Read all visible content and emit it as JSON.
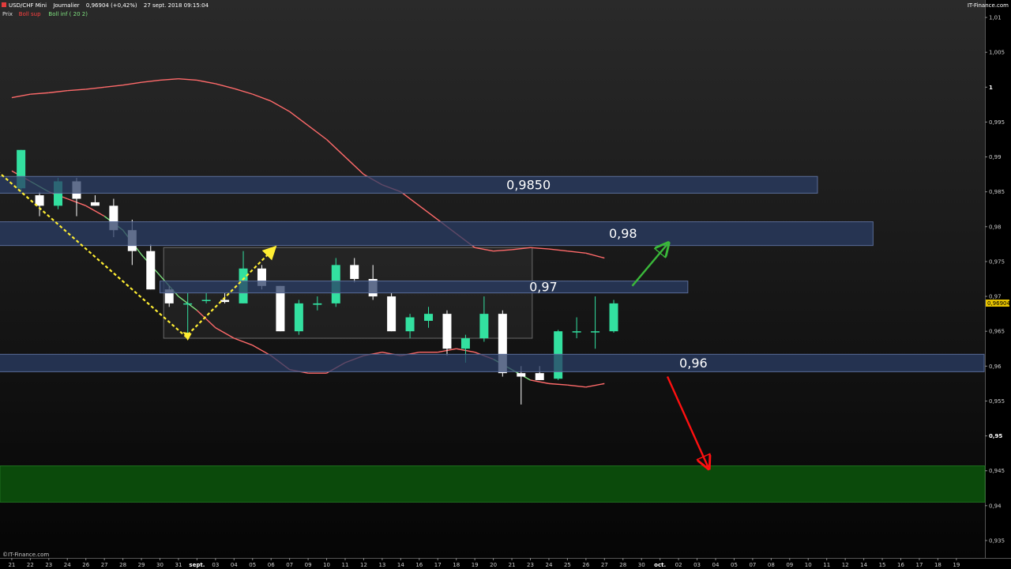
{
  "header": {
    "symbol": "USD/CHF Mini",
    "period": "Journalier",
    "price_change": "0,96904 (+0,42%)",
    "datetime": "27 sept. 2018 09:15:04",
    "source": "IT-Finance.com"
  },
  "legend": [
    {
      "label": "Prix",
      "color": "#dddddd"
    },
    {
      "label": "Boll sup",
      "color": "#ff4040"
    },
    {
      "label": "Boll inf ( 20 2)",
      "color": "#7fe27f"
    }
  ],
  "footer": {
    "copyright": "©IT-Finance.com"
  },
  "colors": {
    "background": "#000000",
    "plot_gradient_top": "#2a2a2a",
    "plot_gradient_bottom": "#050505",
    "bull": "#33e0a0",
    "bear": "#ffffff",
    "zone_fill": "#2b3d66",
    "target_zone": "#0b4a0b",
    "price_tag": "#e8c400"
  },
  "chart_data": {
    "type": "candlestick",
    "y_axis": {
      "ylim": [
        0.9325,
        1.0125
      ],
      "ticks": [
        {
          "value": 1.01,
          "label": "1,01"
        },
        {
          "value": 1.005,
          "label": "1,005"
        },
        {
          "value": 1.0,
          "label": "1",
          "bold": true
        },
        {
          "value": 0.995,
          "label": "0,995"
        },
        {
          "value": 0.99,
          "label": "0,99"
        },
        {
          "value": 0.985,
          "label": "0,985"
        },
        {
          "value": 0.98,
          "label": "0,98"
        },
        {
          "value": 0.975,
          "label": "0,975"
        },
        {
          "value": 0.97,
          "label": "0,97"
        },
        {
          "value": 0.965,
          "label": "0,965"
        },
        {
          "value": 0.96,
          "label": "0,96"
        },
        {
          "value": 0.955,
          "label": "0,955"
        },
        {
          "value": 0.95,
          "label": "0,95",
          "bold": true
        },
        {
          "value": 0.945,
          "label": "0,945"
        },
        {
          "value": 0.94,
          "label": "0,94"
        },
        {
          "value": 0.935,
          "label": "0,935"
        }
      ],
      "current_price": {
        "value": 0.96904,
        "label": "0,96904"
      }
    },
    "x_axis": {
      "ticks": [
        {
          "label": "21"
        },
        {
          "label": "22"
        },
        {
          "label": "23"
        },
        {
          "label": "24"
        },
        {
          "label": "26"
        },
        {
          "label": "27"
        },
        {
          "label": "28"
        },
        {
          "label": "29"
        },
        {
          "label": "30"
        },
        {
          "label": "31"
        },
        {
          "label": "sept.",
          "bold": true
        },
        {
          "label": "03"
        },
        {
          "label": "04"
        },
        {
          "label": "05"
        },
        {
          "label": "06"
        },
        {
          "label": "07"
        },
        {
          "label": "09"
        },
        {
          "label": "10"
        },
        {
          "label": "11"
        },
        {
          "label": "12"
        },
        {
          "label": "13"
        },
        {
          "label": "14"
        },
        {
          "label": "16"
        },
        {
          "label": "17"
        },
        {
          "label": "18"
        },
        {
          "label": "19"
        },
        {
          "label": "20"
        },
        {
          "label": "21"
        },
        {
          "label": "23"
        },
        {
          "label": "24"
        },
        {
          "label": "25"
        },
        {
          "label": "26"
        },
        {
          "label": "27"
        },
        {
          "label": "28"
        },
        {
          "label": "30"
        },
        {
          "label": "oct.",
          "bold": true
        },
        {
          "label": "02"
        },
        {
          "label": "03"
        },
        {
          "label": "04"
        },
        {
          "label": "05"
        },
        {
          "label": "07"
        },
        {
          "label": "08"
        },
        {
          "label": "09"
        },
        {
          "label": "10"
        },
        {
          "label": "11"
        },
        {
          "label": "12"
        },
        {
          "label": "14"
        },
        {
          "label": "15"
        },
        {
          "label": "16"
        },
        {
          "label": "17"
        },
        {
          "label": "18"
        },
        {
          "label": "19"
        }
      ]
    },
    "candles": [
      {
        "i": 0.5,
        "o": 0.9855,
        "h": 0.991,
        "l": 0.985,
        "c": 0.991
      },
      {
        "i": 1.5,
        "o": 0.9845,
        "h": 0.985,
        "l": 0.9815,
        "c": 0.983
      },
      {
        "i": 2.5,
        "o": 0.983,
        "h": 0.987,
        "l": 0.9825,
        "c": 0.9865
      },
      {
        "i": 3.5,
        "o": 0.9865,
        "h": 0.987,
        "l": 0.9815,
        "c": 0.984
      },
      {
        "i": 4.5,
        "o": 0.9835,
        "h": 0.9845,
        "l": 0.983,
        "c": 0.983
      },
      {
        "i": 5.5,
        "o": 0.983,
        "h": 0.984,
        "l": 0.9785,
        "c": 0.9795
      },
      {
        "i": 6.5,
        "o": 0.9795,
        "h": 0.981,
        "l": 0.9745,
        "c": 0.9765
      },
      {
        "i": 7.5,
        "o": 0.9765,
        "h": 0.9775,
        "l": 0.971,
        "c": 0.971
      },
      {
        "i": 8.5,
        "o": 0.971,
        "h": 0.9715,
        "l": 0.9685,
        "c": 0.969
      },
      {
        "i": 9.5,
        "o": 0.969,
        "h": 0.9705,
        "l": 0.964,
        "c": 0.969
      },
      {
        "i": 10.5,
        "o": 0.9695,
        "h": 0.9705,
        "l": 0.969,
        "c": 0.9695
      },
      {
        "i": 11.5,
        "o": 0.9695,
        "h": 0.9705,
        "l": 0.969,
        "c": 0.9692
      },
      {
        "i": 12.5,
        "o": 0.969,
        "h": 0.9765,
        "l": 0.969,
        "c": 0.974
      },
      {
        "i": 13.5,
        "o": 0.974,
        "h": 0.9745,
        "l": 0.971,
        "c": 0.9715
      },
      {
        "i": 14.5,
        "o": 0.9715,
        "h": 0.9715,
        "l": 0.965,
        "c": 0.965
      },
      {
        "i": 15.5,
        "o": 0.965,
        "h": 0.9695,
        "l": 0.9645,
        "c": 0.969
      },
      {
        "i": 16.5,
        "o": 0.9688,
        "h": 0.97,
        "l": 0.968,
        "c": 0.969
      },
      {
        "i": 17.5,
        "o": 0.969,
        "h": 0.9755,
        "l": 0.9685,
        "c": 0.9745
      },
      {
        "i": 18.5,
        "o": 0.9745,
        "h": 0.9755,
        "l": 0.972,
        "c": 0.9725
      },
      {
        "i": 19.5,
        "o": 0.9725,
        "h": 0.9745,
        "l": 0.9695,
        "c": 0.97
      },
      {
        "i": 20.5,
        "o": 0.97,
        "h": 0.9705,
        "l": 0.965,
        "c": 0.965
      },
      {
        "i": 21.5,
        "o": 0.965,
        "h": 0.9675,
        "l": 0.964,
        "c": 0.967
      },
      {
        "i": 22.5,
        "o": 0.9665,
        "h": 0.9685,
        "l": 0.9655,
        "c": 0.9675
      },
      {
        "i": 23.5,
        "o": 0.9675,
        "h": 0.968,
        "l": 0.9615,
        "c": 0.9625
      },
      {
        "i": 24.5,
        "o": 0.9625,
        "h": 0.9645,
        "l": 0.9605,
        "c": 0.964
      },
      {
        "i": 25.5,
        "o": 0.964,
        "h": 0.97,
        "l": 0.9635,
        "c": 0.9675
      },
      {
        "i": 26.5,
        "o": 0.9675,
        "h": 0.968,
        "l": 0.9585,
        "c": 0.959
      },
      {
        "i": 27.5,
        "o": 0.959,
        "h": 0.96,
        "l": 0.9545,
        "c": 0.9585
      },
      {
        "i": 28.5,
        "o": 0.959,
        "h": 0.96,
        "l": 0.958,
        "c": 0.958
      },
      {
        "i": 29.5,
        "o": 0.9582,
        "h": 0.9652,
        "l": 0.958,
        "c": 0.965
      },
      {
        "i": 30.5,
        "o": 0.965,
        "h": 0.967,
        "l": 0.964,
        "c": 0.965
      },
      {
        "i": 31.5,
        "o": 0.965,
        "h": 0.97,
        "l": 0.9625,
        "c": 0.965
      },
      {
        "i": 32.5,
        "o": 0.965,
        "h": 0.9695,
        "l": 0.9648,
        "c": 0.969
      }
    ],
    "series": [
      {
        "role": "Boll sup",
        "points": [
          [
            0,
            0.988
          ],
          [
            1,
            0.9865
          ],
          [
            2,
            0.985
          ],
          [
            3,
            0.984
          ],
          [
            4,
            0.983
          ],
          [
            5,
            0.9815
          ],
          [
            6,
            0.9795
          ],
          [
            7,
            0.976
          ],
          [
            8,
            0.973
          ],
          [
            9,
            0.97
          ],
          [
            10,
            0.968
          ],
          [
            11,
            0.9655
          ],
          [
            12,
            0.964
          ],
          [
            13,
            0.963
          ],
          [
            14,
            0.9615
          ],
          [
            15,
            0.9595
          ],
          [
            16,
            0.959
          ],
          [
            17,
            0.959
          ],
          [
            18,
            0.9605
          ],
          [
            19,
            0.9615
          ],
          [
            20,
            0.962
          ],
          [
            21,
            0.9615
          ],
          [
            22,
            0.962
          ],
          [
            23,
            0.962
          ],
          [
            24,
            0.9625
          ],
          [
            25,
            0.962
          ],
          [
            26,
            0.961
          ],
          [
            27,
            0.9595
          ],
          [
            28,
            0.958
          ],
          [
            29,
            0.9575
          ],
          [
            30,
            0.9573
          ],
          [
            31,
            0.957
          ],
          [
            32,
            0.9575
          ]
        ]
      },
      {
        "role": "Boll inf",
        "points": [
          [
            0,
            0.9985
          ],
          [
            1,
            0.999
          ],
          [
            2,
            0.9992
          ],
          [
            3,
            0.9995
          ],
          [
            4,
            0.9997
          ],
          [
            5,
            1.0
          ],
          [
            6,
            1.0003
          ],
          [
            7,
            1.0007
          ],
          [
            8,
            1.001
          ],
          [
            9,
            1.0012
          ],
          [
            10,
            1.001
          ],
          [
            11,
            1.0005
          ],
          [
            12,
            0.9998
          ],
          [
            13,
            0.999
          ],
          [
            14,
            0.998
          ],
          [
            15,
            0.9965
          ],
          [
            16,
            0.9945
          ],
          [
            17,
            0.9925
          ],
          [
            18,
            0.99
          ],
          [
            19,
            0.9875
          ],
          [
            20,
            0.986
          ],
          [
            21,
            0.985
          ],
          [
            22,
            0.983
          ],
          [
            23,
            0.981
          ],
          [
            24,
            0.979
          ],
          [
            25,
            0.977
          ],
          [
            26,
            0.9765
          ],
          [
            27,
            0.9767
          ],
          [
            28,
            0.977
          ],
          [
            29,
            0.9768
          ],
          [
            30,
            0.9765
          ],
          [
            31,
            0.9762
          ],
          [
            32,
            0.9755
          ]
        ]
      }
    ],
    "zones": [
      {
        "label": "0,9850",
        "from_i": -1,
        "to_i": 43.5,
        "y1": 0.9848,
        "y2": 0.9872
      },
      {
        "label": "0,98",
        "from_i": -1,
        "to_i": 46.5,
        "y1": 0.9773,
        "y2": 0.9807
      },
      {
        "label": "0,97",
        "from_i": 8,
        "to_i": 36.5,
        "y1": 0.9705,
        "y2": 0.9722
      },
      {
        "label": "0,96",
        "from_i": -1,
        "to_i": 52.5,
        "y1": 0.9592,
        "y2": 0.9617
      }
    ],
    "range_box": {
      "from_i": 8.2,
      "to_i": 28.1,
      "y1": 0.964,
      "y2": 0.977
    },
    "target_zone": {
      "y1": 0.9405,
      "y2": 0.9457
    },
    "annotations": [
      {
        "kind": "dotted-line",
        "color": "#ffee33",
        "points": [
          [
            -1,
            0.9885
          ],
          [
            9.5,
            0.964
          ]
        ]
      },
      {
        "kind": "dotted-arrow",
        "color": "#ffee33",
        "points": [
          [
            9.5,
            0.9645
          ],
          [
            14.2,
            0.977
          ]
        ]
      },
      {
        "kind": "arrow",
        "color": "#3ab83a",
        "points": [
          [
            33.5,
            0.9715
          ],
          [
            35.4,
            0.9775
          ]
        ]
      },
      {
        "kind": "arrow",
        "color": "#ff1010",
        "points": [
          [
            35.4,
            0.9585
          ],
          [
            37.6,
            0.9455
          ]
        ]
      }
    ]
  }
}
